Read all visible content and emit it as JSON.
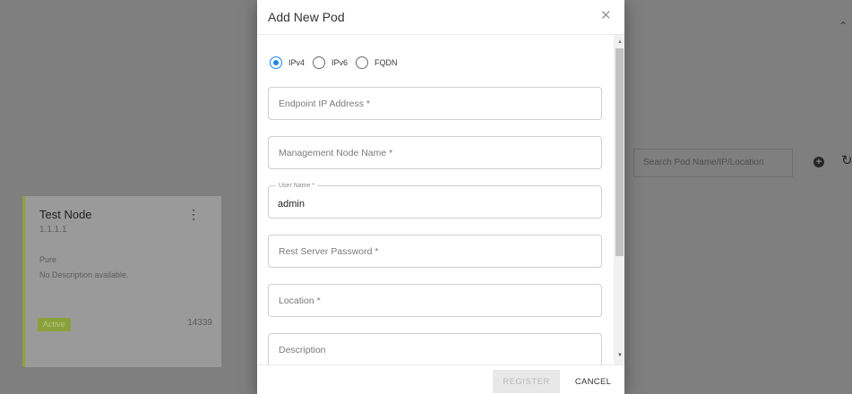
{
  "background": {
    "node_card": {
      "title": "Test Node",
      "ip": "1.1.1.1",
      "type": "Pure",
      "description": "No Description available.",
      "status": "Active",
      "port": "14339",
      "menu_icon": "more-vert-icon"
    },
    "search": {
      "placeholder": "Search Pod Name/IP/Location"
    },
    "icons": {
      "add": "add-circle-icon",
      "refresh": "refresh-icon",
      "collapse": "chevron-up-icon"
    }
  },
  "dialog": {
    "title": "Add New Pod",
    "close_icon": "close-icon",
    "address_types": [
      {
        "label": "IPv4",
        "checked": true
      },
      {
        "label": "IPv6",
        "checked": false
      },
      {
        "label": "FQDN",
        "checked": false
      }
    ],
    "fields": {
      "endpoint": {
        "placeholder": "Endpoint IP Address *"
      },
      "management_node": {
        "placeholder": "Management Node Name *"
      },
      "user_name": {
        "label": "User Name *",
        "value": "admin"
      },
      "password": {
        "placeholder": "Rest Server Password *"
      },
      "location": {
        "placeholder": "Location *"
      },
      "description": {
        "placeholder": "Description"
      }
    },
    "buttons": {
      "register": "REGISTER",
      "cancel": "CANCEL"
    }
  },
  "colors": {
    "accent": "#1e88e5",
    "status_active": "#8aa13b"
  }
}
